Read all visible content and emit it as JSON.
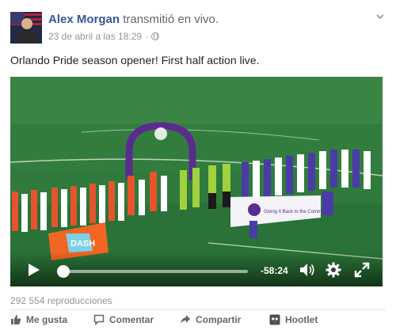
{
  "post": {
    "author": "Alex Morgan",
    "action_text": "transmitió en vivo.",
    "timestamp": "23 de abril a las 18:29",
    "separator": "·",
    "text": "Orlando Pride season opener! First half action live."
  },
  "video": {
    "time_remaining": "-58:24",
    "progress_fraction": 0.03,
    "banner_text": "Giving It Back to the Community",
    "sign_text": "DASH"
  },
  "stats": {
    "views": "292 554 reproducciones"
  },
  "actions": {
    "like_label": "Me gusta",
    "comment_label": "Comentar",
    "share_label": "Compartir",
    "hootlet_label": "Hootlet"
  },
  "colors": {
    "link_blue": "#365899",
    "meta_gray": "#90949c",
    "pitch_green": "#2f7a3c",
    "pride_purple": "#5b2c8f",
    "dash_orange": "#f26522"
  },
  "icons": [
    "globe-icon",
    "chevron-down-icon",
    "play-icon",
    "volume-icon",
    "gear-icon",
    "fullscreen-icon",
    "like-icon",
    "comment-icon",
    "share-icon",
    "hootlet-icon"
  ]
}
